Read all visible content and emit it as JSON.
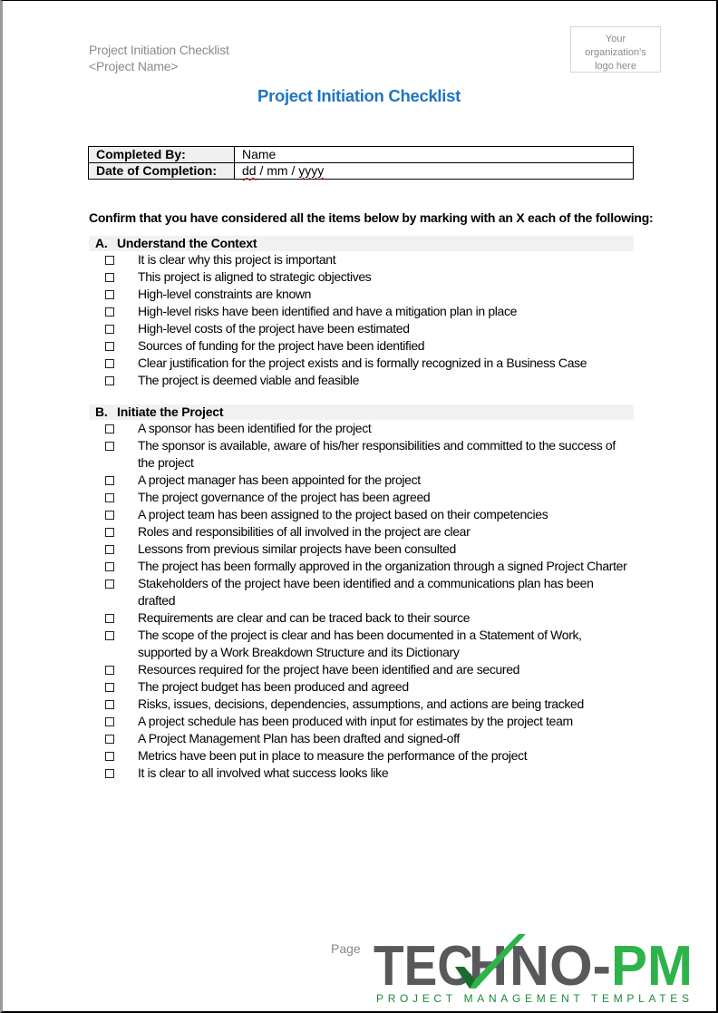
{
  "header": {
    "doc_title": "Project Initiation Checklist",
    "project_name": "<Project Name>",
    "logo_placeholder": [
      "Your",
      "organization's",
      "logo here"
    ]
  },
  "title": "Project Initiation Checklist",
  "info_table": {
    "completed_by_label": "Completed By:",
    "completed_by_value": "Name",
    "date_label": "Date of Completion:",
    "date_value_parts": [
      "dd",
      " / mm / ",
      "yyyy"
    ]
  },
  "intro": "Confirm that you have considered all the items below by marking with an X each of the following:",
  "sections": [
    {
      "letter": "A.",
      "title": "Understand the Context",
      "items": [
        "It is clear why this project is important",
        "This project is aligned to strategic objectives",
        "High-level constraints are known",
        "High-level risks have been identified and have a mitigation plan in place",
        "High-level costs of the project have been estimated",
        "Sources of funding for the project have been identified",
        "Clear justification for the project exists and is formally recognized in a Business Case",
        "The project is deemed viable and feasible"
      ]
    },
    {
      "letter": "B.",
      "title": "Initiate the Project",
      "items": [
        "A sponsor has been identified for the project",
        "The sponsor is available, aware of his/her responsibilities and committed to the success of the project",
        "A project manager has been appointed for the project",
        "The project governance of the project has been agreed",
        "A project team has been assigned to the project based on their competencies",
        "Roles and responsibilities of all involved in the project are clear",
        "Lessons from previous similar projects have been consulted",
        "The project has been formally approved in the organization through a signed Project Charter",
        "Stakeholders of the project have been identified and a communications plan has been drafted",
        "Requirements are clear and can be traced back to their source",
        "The scope of the project is clear and has been documented in a Statement of Work, supported by a Work Breakdown Structure and its Dictionary",
        "Resources required for the project have been identified and are secured",
        "The project budget has been produced and agreed",
        "Risks, issues, decisions, dependencies, assumptions, and actions are being tracked",
        "A project schedule has been produced with input for estimates by the project team",
        "A Project Management Plan has been drafted and signed-off",
        "Metrics have been put in place to measure the performance of the project",
        "It is clear to all involved what success looks like"
      ]
    }
  ],
  "footer": {
    "page_label": "Page",
    "brand_part1": "TEC",
    "brand_part2": "NO-",
    "brand_part3": "PM",
    "brand_tagline": "PROJECT MANAGEMENT TEMPLATES",
    "colors": {
      "gray": "#58595b",
      "green": "#2db34a",
      "dark_green": "#1a6b2e"
    }
  },
  "colors": {
    "title_blue": "#1f74c2",
    "header_gray": "#8a8a8a",
    "section_bg": "#f1f1f1"
  }
}
